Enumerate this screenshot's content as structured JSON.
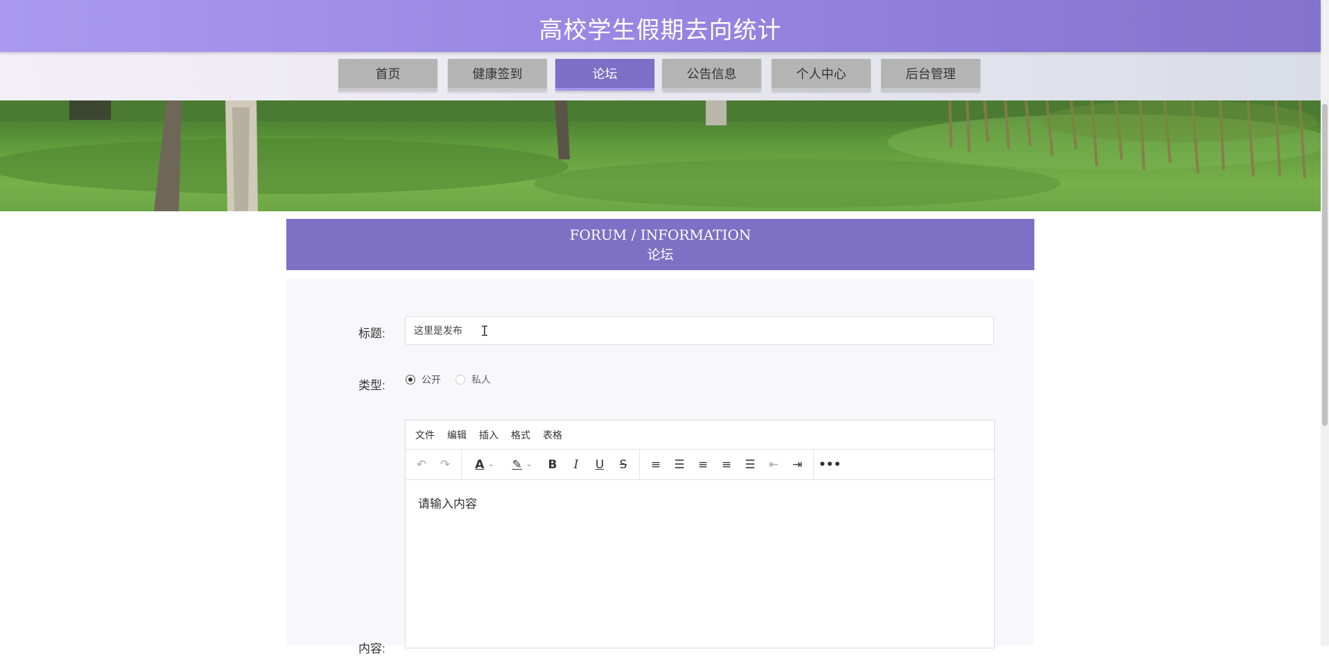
{
  "header": {
    "title": "高校学生假期去向统计"
  },
  "nav": {
    "items": [
      {
        "label": "首页"
      },
      {
        "label": "健康签到"
      },
      {
        "label": "论坛"
      },
      {
        "label": "公告信息"
      },
      {
        "label": "个人中心"
      },
      {
        "label": "后台管理"
      }
    ],
    "active_index": 2
  },
  "section": {
    "title_en": "FORUM / INFORMATION",
    "title_cn": "论坛"
  },
  "form": {
    "title_label": "标题:",
    "title_value": "这里是发布",
    "type_label": "类型:",
    "type_options": [
      {
        "label": "公开",
        "checked": true
      },
      {
        "label": "私人",
        "checked": false
      }
    ],
    "content_label": "内容:"
  },
  "editor": {
    "menu": [
      "文件",
      "编辑",
      "插入",
      "格式",
      "表格"
    ],
    "toolbar_icons": [
      "undo-icon",
      "redo-icon",
      "font-color-icon",
      "highlight-icon",
      "bold-icon",
      "italic-icon",
      "underline-icon",
      "strikethrough-icon",
      "line-height-icon",
      "align-left-icon",
      "align-center-icon",
      "align-right-icon",
      "align-justify-icon",
      "outdent-icon",
      "indent-icon",
      "more-icon"
    ],
    "placeholder": "请输入内容"
  },
  "colors": {
    "header_start": "#a99af0",
    "header_end": "#8473cd",
    "nav_active": "#7e6fc6",
    "nav_inactive": "#b4b4b4",
    "section_head": "#7e70c4"
  }
}
